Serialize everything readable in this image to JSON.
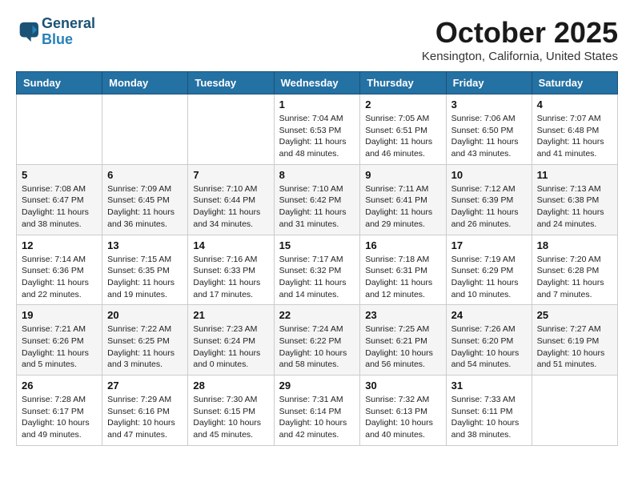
{
  "header": {
    "logo_line1": "General",
    "logo_line2": "Blue",
    "month": "October 2025",
    "location": "Kensington, California, United States"
  },
  "weekdays": [
    "Sunday",
    "Monday",
    "Tuesday",
    "Wednesday",
    "Thursday",
    "Friday",
    "Saturday"
  ],
  "weeks": [
    [
      {
        "day": "",
        "info": ""
      },
      {
        "day": "",
        "info": ""
      },
      {
        "day": "",
        "info": ""
      },
      {
        "day": "1",
        "info": "Sunrise: 7:04 AM\nSunset: 6:53 PM\nDaylight: 11 hours\nand 48 minutes."
      },
      {
        "day": "2",
        "info": "Sunrise: 7:05 AM\nSunset: 6:51 PM\nDaylight: 11 hours\nand 46 minutes."
      },
      {
        "day": "3",
        "info": "Sunrise: 7:06 AM\nSunset: 6:50 PM\nDaylight: 11 hours\nand 43 minutes."
      },
      {
        "day": "4",
        "info": "Sunrise: 7:07 AM\nSunset: 6:48 PM\nDaylight: 11 hours\nand 41 minutes."
      }
    ],
    [
      {
        "day": "5",
        "info": "Sunrise: 7:08 AM\nSunset: 6:47 PM\nDaylight: 11 hours\nand 38 minutes."
      },
      {
        "day": "6",
        "info": "Sunrise: 7:09 AM\nSunset: 6:45 PM\nDaylight: 11 hours\nand 36 minutes."
      },
      {
        "day": "7",
        "info": "Sunrise: 7:10 AM\nSunset: 6:44 PM\nDaylight: 11 hours\nand 34 minutes."
      },
      {
        "day": "8",
        "info": "Sunrise: 7:10 AM\nSunset: 6:42 PM\nDaylight: 11 hours\nand 31 minutes."
      },
      {
        "day": "9",
        "info": "Sunrise: 7:11 AM\nSunset: 6:41 PM\nDaylight: 11 hours\nand 29 minutes."
      },
      {
        "day": "10",
        "info": "Sunrise: 7:12 AM\nSunset: 6:39 PM\nDaylight: 11 hours\nand 26 minutes."
      },
      {
        "day": "11",
        "info": "Sunrise: 7:13 AM\nSunset: 6:38 PM\nDaylight: 11 hours\nand 24 minutes."
      }
    ],
    [
      {
        "day": "12",
        "info": "Sunrise: 7:14 AM\nSunset: 6:36 PM\nDaylight: 11 hours\nand 22 minutes."
      },
      {
        "day": "13",
        "info": "Sunrise: 7:15 AM\nSunset: 6:35 PM\nDaylight: 11 hours\nand 19 minutes."
      },
      {
        "day": "14",
        "info": "Sunrise: 7:16 AM\nSunset: 6:33 PM\nDaylight: 11 hours\nand 17 minutes."
      },
      {
        "day": "15",
        "info": "Sunrise: 7:17 AM\nSunset: 6:32 PM\nDaylight: 11 hours\nand 14 minutes."
      },
      {
        "day": "16",
        "info": "Sunrise: 7:18 AM\nSunset: 6:31 PM\nDaylight: 11 hours\nand 12 minutes."
      },
      {
        "day": "17",
        "info": "Sunrise: 7:19 AM\nSunset: 6:29 PM\nDaylight: 11 hours\nand 10 minutes."
      },
      {
        "day": "18",
        "info": "Sunrise: 7:20 AM\nSunset: 6:28 PM\nDaylight: 11 hours\nand 7 minutes."
      }
    ],
    [
      {
        "day": "19",
        "info": "Sunrise: 7:21 AM\nSunset: 6:26 PM\nDaylight: 11 hours\nand 5 minutes."
      },
      {
        "day": "20",
        "info": "Sunrise: 7:22 AM\nSunset: 6:25 PM\nDaylight: 11 hours\nand 3 minutes."
      },
      {
        "day": "21",
        "info": "Sunrise: 7:23 AM\nSunset: 6:24 PM\nDaylight: 11 hours\nand 0 minutes."
      },
      {
        "day": "22",
        "info": "Sunrise: 7:24 AM\nSunset: 6:22 PM\nDaylight: 10 hours\nand 58 minutes."
      },
      {
        "day": "23",
        "info": "Sunrise: 7:25 AM\nSunset: 6:21 PM\nDaylight: 10 hours\nand 56 minutes."
      },
      {
        "day": "24",
        "info": "Sunrise: 7:26 AM\nSunset: 6:20 PM\nDaylight: 10 hours\nand 54 minutes."
      },
      {
        "day": "25",
        "info": "Sunrise: 7:27 AM\nSunset: 6:19 PM\nDaylight: 10 hours\nand 51 minutes."
      }
    ],
    [
      {
        "day": "26",
        "info": "Sunrise: 7:28 AM\nSunset: 6:17 PM\nDaylight: 10 hours\nand 49 minutes."
      },
      {
        "day": "27",
        "info": "Sunrise: 7:29 AM\nSunset: 6:16 PM\nDaylight: 10 hours\nand 47 minutes."
      },
      {
        "day": "28",
        "info": "Sunrise: 7:30 AM\nSunset: 6:15 PM\nDaylight: 10 hours\nand 45 minutes."
      },
      {
        "day": "29",
        "info": "Sunrise: 7:31 AM\nSunset: 6:14 PM\nDaylight: 10 hours\nand 42 minutes."
      },
      {
        "day": "30",
        "info": "Sunrise: 7:32 AM\nSunset: 6:13 PM\nDaylight: 10 hours\nand 40 minutes."
      },
      {
        "day": "31",
        "info": "Sunrise: 7:33 AM\nSunset: 6:11 PM\nDaylight: 10 hours\nand 38 minutes."
      },
      {
        "day": "",
        "info": ""
      }
    ]
  ]
}
